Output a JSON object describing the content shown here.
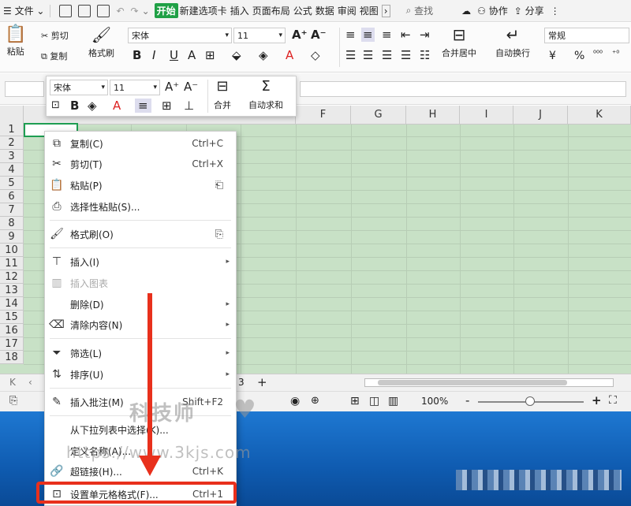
{
  "topbar": {
    "menu_label": "文件",
    "tabs": [
      "开始",
      "新建选项卡",
      "插入",
      "页面布局",
      "公式",
      "数据",
      "审阅",
      "视图"
    ],
    "active_tab": "开始",
    "search": "查找",
    "collab": "协作",
    "share": "分享"
  },
  "ribbon": {
    "paste": "粘贴",
    "cut": "剪切",
    "copy": "复制",
    "format_painter": "格式刷",
    "font_name": "宋体",
    "font_size": "11",
    "merge": "合并居中",
    "wrap": "自动换行",
    "number_format": "常规",
    "currency": "¥",
    "percent": "%"
  },
  "mini_toolbar": {
    "font_name": "宋体",
    "font_size": "11",
    "merge": "合并",
    "autosum": "自动求和"
  },
  "columns": [
    "F",
    "G",
    "H",
    "I",
    "J",
    "K"
  ],
  "rows": [
    "1",
    "2",
    "3",
    "4",
    "5",
    "6",
    "7",
    "8",
    "9",
    "10",
    "11",
    "12",
    "13",
    "14",
    "15",
    "16",
    "17",
    "18"
  ],
  "context_menu": [
    {
      "label": "复制(C)",
      "shortcut": "Ctrl+C",
      "icon": "copy-icon"
    },
    {
      "label": "剪切(T)",
      "shortcut": "Ctrl+X",
      "icon": "scissors-icon"
    },
    {
      "label": "粘贴(P)",
      "shortcut": "",
      "icon": "paste-icon"
    },
    {
      "label": "选择性粘贴(S)...",
      "shortcut": "",
      "icon": "paste-special-icon"
    },
    {
      "label": "格式刷(O)",
      "shortcut": "",
      "icon": "brush-icon"
    },
    {
      "label": "插入(I)",
      "shortcut": "",
      "icon": "insert-icon"
    },
    {
      "label": "插入图表",
      "shortcut": "",
      "icon": "chart-icon"
    },
    {
      "label": "删除(D)",
      "shortcut": "",
      "icon": ""
    },
    {
      "label": "清除内容(N)",
      "shortcut": "",
      "icon": "eraser-icon"
    },
    {
      "label": "筛选(L)",
      "shortcut": "",
      "icon": "filter-icon"
    },
    {
      "label": "排序(U)",
      "shortcut": "",
      "icon": "sort-icon"
    },
    {
      "label": "插入批注(M)",
      "shortcut": "Shift+F2",
      "icon": "comment-icon"
    },
    {
      "label": "从下拉列表中选择(K)...",
      "shortcut": "",
      "icon": ""
    },
    {
      "label": "定义名称(A)...",
      "shortcut": "",
      "icon": ""
    },
    {
      "label": "超链接(H)...",
      "shortcut": "Ctrl+K",
      "icon": "link-icon"
    },
    {
      "label": "设置单元格格式(F)...",
      "shortcut": "Ctrl+1",
      "icon": "format-cells-icon"
    }
  ],
  "sheetbar": {
    "sheet_num": "3",
    "add": "+"
  },
  "statusbar": {
    "zoom": "100%",
    "minus": "-",
    "plus": "+"
  },
  "watermark": {
    "name": "科技师",
    "url": "https://www.3kjs.com"
  }
}
